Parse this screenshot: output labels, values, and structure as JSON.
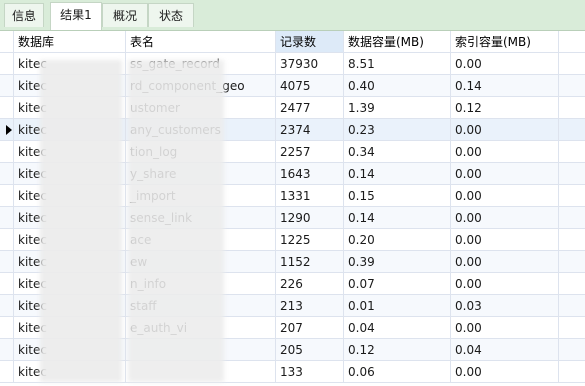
{
  "tabs": [
    {
      "label": "信息"
    },
    {
      "label": "结果1"
    },
    {
      "label": "概况"
    },
    {
      "label": "状态"
    }
  ],
  "columns": [
    "数据库",
    "表名",
    "记录数",
    "数据容量(MB)",
    "索引容量(MB)"
  ],
  "rows": [
    {
      "db": "kitec",
      "table": "ss_gate_record",
      "records": "37930",
      "data": "8.51",
      "index": "0.00"
    },
    {
      "db": "kitec",
      "table": "rd_component_geo",
      "records": "4075",
      "data": "0.40",
      "index": "0.14"
    },
    {
      "db": "kitec",
      "table": "ustomer",
      "records": "2477",
      "data": "1.39",
      "index": "0.12"
    },
    {
      "db": "kitec",
      "table": "any_customers",
      "records": "2374",
      "data": "0.23",
      "index": "0.00"
    },
    {
      "db": "kitec",
      "table": "tion_log",
      "records": "2257",
      "data": "0.34",
      "index": "0.00"
    },
    {
      "db": "kitec",
      "table": "y_share",
      "records": "1643",
      "data": "0.14",
      "index": "0.00"
    },
    {
      "db": "kitec",
      "table": "_import",
      "records": "1331",
      "data": "0.15",
      "index": "0.00"
    },
    {
      "db": "kitec",
      "table": "sense_link",
      "records": "1290",
      "data": "0.14",
      "index": "0.00"
    },
    {
      "db": "kitec",
      "table": "ace",
      "records": "1225",
      "data": "0.20",
      "index": "0.00"
    },
    {
      "db": "kitec",
      "table": "ew",
      "records": "1152",
      "data": "0.39",
      "index": "0.00"
    },
    {
      "db": "kitec",
      "table": "n_info",
      "records": "226",
      "data": "0.07",
      "index": "0.00"
    },
    {
      "db": "kitec",
      "table": "staff",
      "records": "213",
      "data": "0.01",
      "index": "0.03"
    },
    {
      "db": "kitec",
      "table": "e_auth_vi",
      "records": "207",
      "data": "0.04",
      "index": "0.00"
    },
    {
      "db": "kitec",
      "table": "",
      "records": "205",
      "data": "0.12",
      "index": "0.04"
    },
    {
      "db": "kitec",
      "table": "",
      "records": "133",
      "data": "0.06",
      "index": "0.00"
    }
  ]
}
